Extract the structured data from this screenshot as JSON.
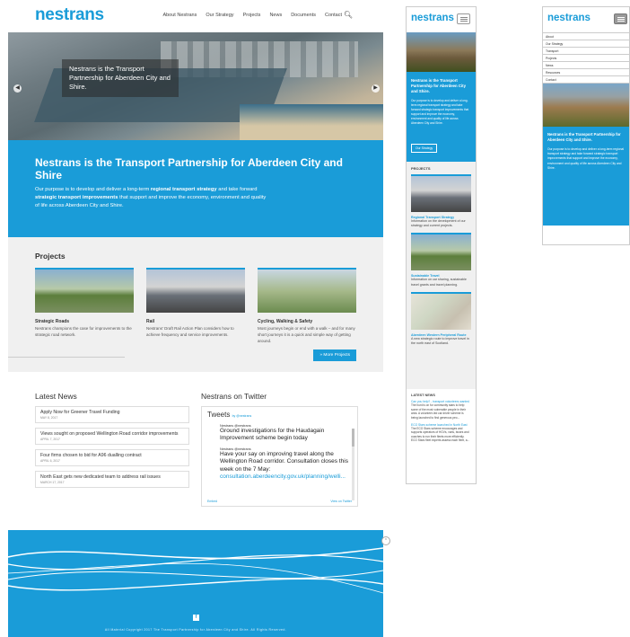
{
  "site": {
    "logo": "nestrans"
  },
  "nav": {
    "items": [
      "About Nestrans",
      "Our Strategy",
      "Projects",
      "News",
      "Documents",
      "Contact"
    ],
    "search_icon": "search-icon"
  },
  "hero": {
    "caption": "Nestrans is the Transport Partnership for Aberdeen City and Shire."
  },
  "intro": {
    "title_brand": "Nestrans",
    "title_rest": " is the Transport Partnership for Aberdeen City and Shire",
    "p1": "Our purpose is to develop and deliver a long-term ",
    "b1": "regional transport strategy",
    "p2": " and take forward ",
    "b2": "strategic transport improvements",
    "p3": " that support and improve the economy, environment and quality of life across Aberdeen City and Shire."
  },
  "projects": {
    "heading": "Projects",
    "items": [
      {
        "title": "Strategic Roads",
        "desc": "Nestrans champions the case for improvements to the strategic road network."
      },
      {
        "title": "Rail",
        "desc": "Nestrans' Draft Rail Action Plan considers how to achieve frequency and service improvements."
      },
      {
        "title": "Cycling, Walking & Safety",
        "desc": "Most journeys begin or end with a walk – and for many short journeys it is a quick and simple way of getting around."
      }
    ],
    "more_label": "» More Projects"
  },
  "news": {
    "heading": "Latest News",
    "items": [
      {
        "title": "Apply Now for Greener Travel Funding",
        "date": "MAY 8, 2017"
      },
      {
        "title": "Views sought on proposed Wellington Road corridor improvements",
        "date": "APRIL 7, 2017"
      },
      {
        "title": "Four firms chosen to bid for A96 dualling contract",
        "date": "APRIL 6, 2017"
      },
      {
        "title": "North East gets new dedicated team to address rail issues",
        "date": "MARCH 17, 2017"
      }
    ]
  },
  "twitter": {
    "heading": "Nestrans on Twitter",
    "box_title": "Tweets",
    "box_by": "by @nestrans",
    "tweets": [
      {
        "who": "Nestrans @nestrans",
        "body": "Ground investigations for the Haudagain Improvement scheme begin today",
        "link": ""
      },
      {
        "who": "Nestrans @nestrans",
        "body": "Have your say on improving travel along the Wellington Road corridor. Consultation closes this week on the 7 May:",
        "link": "consultation.aberdeencity.gov.uk/planning/welli..."
      }
    ],
    "embed": "Embed",
    "view_on": "View on Twitter"
  },
  "footer": {
    "copyright": "All Material Copyright 2017 The Transport Partnership for Aberdeen City and Shire. All Rights Reserved.",
    "facebook": "f"
  },
  "mobile1": {
    "intro_title": "Nestrans is the Transport Partnership for Aberdeen City and Shire.",
    "intro_text": "Our purpose is to develop and deliver a long-term regional transport strategy and take forward strategic transport improvements that support and improve the economy, environment and quality of life across Aberdeen City and Shire.",
    "strategy_btn": "Our Strategy",
    "projects_heading": "PROJECTS",
    "cards": [
      {
        "title": "Regional Transport Strategy",
        "desc": "Information on the development of our strategy and current projects."
      },
      {
        "title": "Sustainable Travel",
        "desc": "Information on car sharing, sustainable travel grants and travel planning."
      },
      {
        "title": "Aberdeen Western Peripheral Route",
        "desc": "A new strategic route to improve travel in the north east of Scotland."
      }
    ],
    "news_heading": "LATEST NEWS",
    "news": [
      {
        "title": "Can you help? - transport volunteers wanted",
        "desc": "The hunt is on for community stars to help some of the most vulnerable people in their area. A volunteer-led car driver scheme is being launched to find generous peo..."
      },
      {
        "title": "ECO Stars scheme launched in North East",
        "desc": "The ECO Stars scheme encourages and supports operators of HGVs, vans, buses and coaches to run their fleets more efficiently. ECO Stars fleet experts assess each fleet, a..."
      }
    ]
  },
  "mobile2": {
    "menu": [
      "About",
      "Our Strategy",
      "Transport",
      "Projects",
      "News",
      "Resources",
      "Contact"
    ],
    "intro_title": "Nestrans is the Transport Partnership for Aberdeen City and Shire.",
    "intro_text": "Our purpose is to develop and deliver a long-term regional transport strategy and take forward strategic transport improvements that support and improve the economy, environment and quality of life across Aberdeen City and Shire."
  },
  "colors": {
    "brand_blue": "#1a9cd8"
  }
}
